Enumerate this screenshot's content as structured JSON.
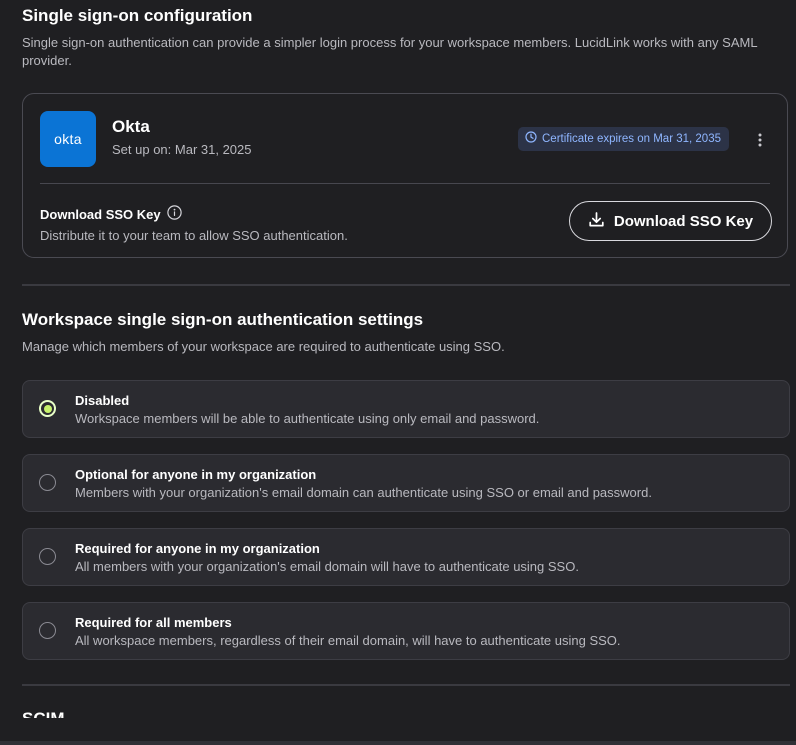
{
  "sso_config": {
    "title": "Single sign-on configuration",
    "description": "Single sign-on authentication can provide a simpler login process for your workspace members. LucidLink works with any SAML provider.",
    "provider": {
      "logo_text": "okta",
      "name": "Okta",
      "setup_text": "Set up on: Mar 31, 2025",
      "certificate_badge": "Certificate expires on Mar 31, 2035",
      "more_icon": "kebab-vertical-icon"
    },
    "download": {
      "title": "Download SSO Key",
      "description": "Distribute it to your team to allow SSO authentication.",
      "button_label": "Download SSO Key",
      "info_icon": "info-icon",
      "download_icon": "download-icon"
    }
  },
  "auth_settings": {
    "title": "Workspace single sign-on authentication settings",
    "description": "Manage which members of your workspace are required to authenticate using SSO.",
    "selected": "disabled",
    "options": [
      {
        "id": "disabled",
        "title": "Disabled",
        "description": "Workspace members will be able to authenticate using only email and password."
      },
      {
        "id": "optional",
        "title": "Optional for anyone in my organization",
        "description": "Members with your organization's email domain can authenticate using SSO or email and password."
      },
      {
        "id": "required-org",
        "title": "Required for anyone in my organization",
        "description": "All members with your organization's email domain will have to authenticate using SSO."
      },
      {
        "id": "required-all",
        "title": "Required for all members",
        "description": "All workspace members, regardless of their email domain, will have to authenticate using SSO."
      }
    ]
  },
  "next_section": {
    "title": "SCIM"
  },
  "colors": {
    "background": "#1f1f22",
    "accent_selected": "#c6f26b",
    "badge_text": "#8fb6ff",
    "okta_blue": "#0b74d5"
  }
}
